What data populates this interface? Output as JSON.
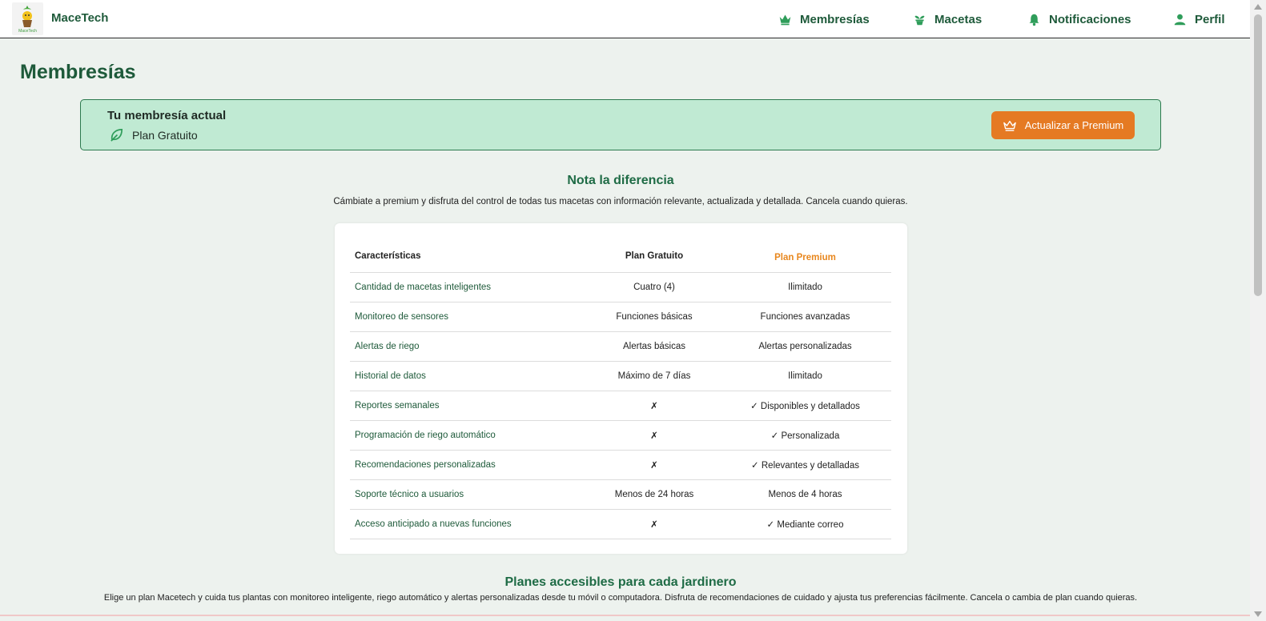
{
  "header": {
    "brand": "MaceTech",
    "logo_text": "MaceTech",
    "nav": [
      {
        "label": "Membresías",
        "icon": "crown-icon"
      },
      {
        "label": "Macetas",
        "icon": "plant-pot-icon"
      },
      {
        "label": "Notificaciones",
        "icon": "bell-icon"
      },
      {
        "label": "Perfil",
        "icon": "user-icon"
      }
    ]
  },
  "page": {
    "title": "Membresías"
  },
  "current_membership": {
    "title": "Tu membresía actual",
    "plan": "Plan Gratuito",
    "plan_icon": "leaf-icon",
    "upgrade_label": "Actualizar a Premium",
    "upgrade_icon": "crown-icon"
  },
  "difference": {
    "title": "Nota la diferencia",
    "subtitle": "Cámbiate a premium y disfruta del control de todas tus macetas con información relevante, actualizada y detallada. Cancela cuando quieras."
  },
  "comparison": {
    "headers": [
      "Características",
      "Plan Gratuito",
      "Plan Premium"
    ],
    "rows": [
      [
        "Cantidad de macetas inteligentes",
        "Cuatro (4)",
        "Ilimitado"
      ],
      [
        "Monitoreo de sensores",
        "Funciones básicas",
        "Funciones avanzadas"
      ],
      [
        "Alertas de riego",
        "Alertas básicas",
        "Alertas personalizadas"
      ],
      [
        "Historial de datos",
        "Máximo de 7 días",
        "Ilimitado"
      ],
      [
        "Reportes semanales",
        "✗",
        "✓ Disponibles y detallados"
      ],
      [
        "Programación de riego automático",
        "✗",
        "✓ Personalizada"
      ],
      [
        "Recomendaciones personalizadas",
        "✗",
        "✓ Relevantes y detalladas"
      ],
      [
        "Soporte técnico a usuarios",
        "Menos de 24 horas",
        "Menos de 4 horas"
      ],
      [
        "Acceso anticipado a nuevas funciones",
        "✗",
        "✓ Mediante correo"
      ]
    ]
  },
  "plans": {
    "title": "Planes accesibles para cada jardinero",
    "subtitle": "Elige un plan Macetech y cuida tus plantas con monitoreo inteligente, riego automático y alertas personalizadas desde tu móvil o computadora. Disfruta de recomendaciones de cuidado y ajusta tus preferencias fácilmente. Cancela o cambia de plan cuando quieras."
  },
  "colors": {
    "primary_green": "#1e5a3a",
    "accent_orange": "#e57a23",
    "banner_bg": "#c0ead3",
    "page_bg": "#edf2ee"
  }
}
